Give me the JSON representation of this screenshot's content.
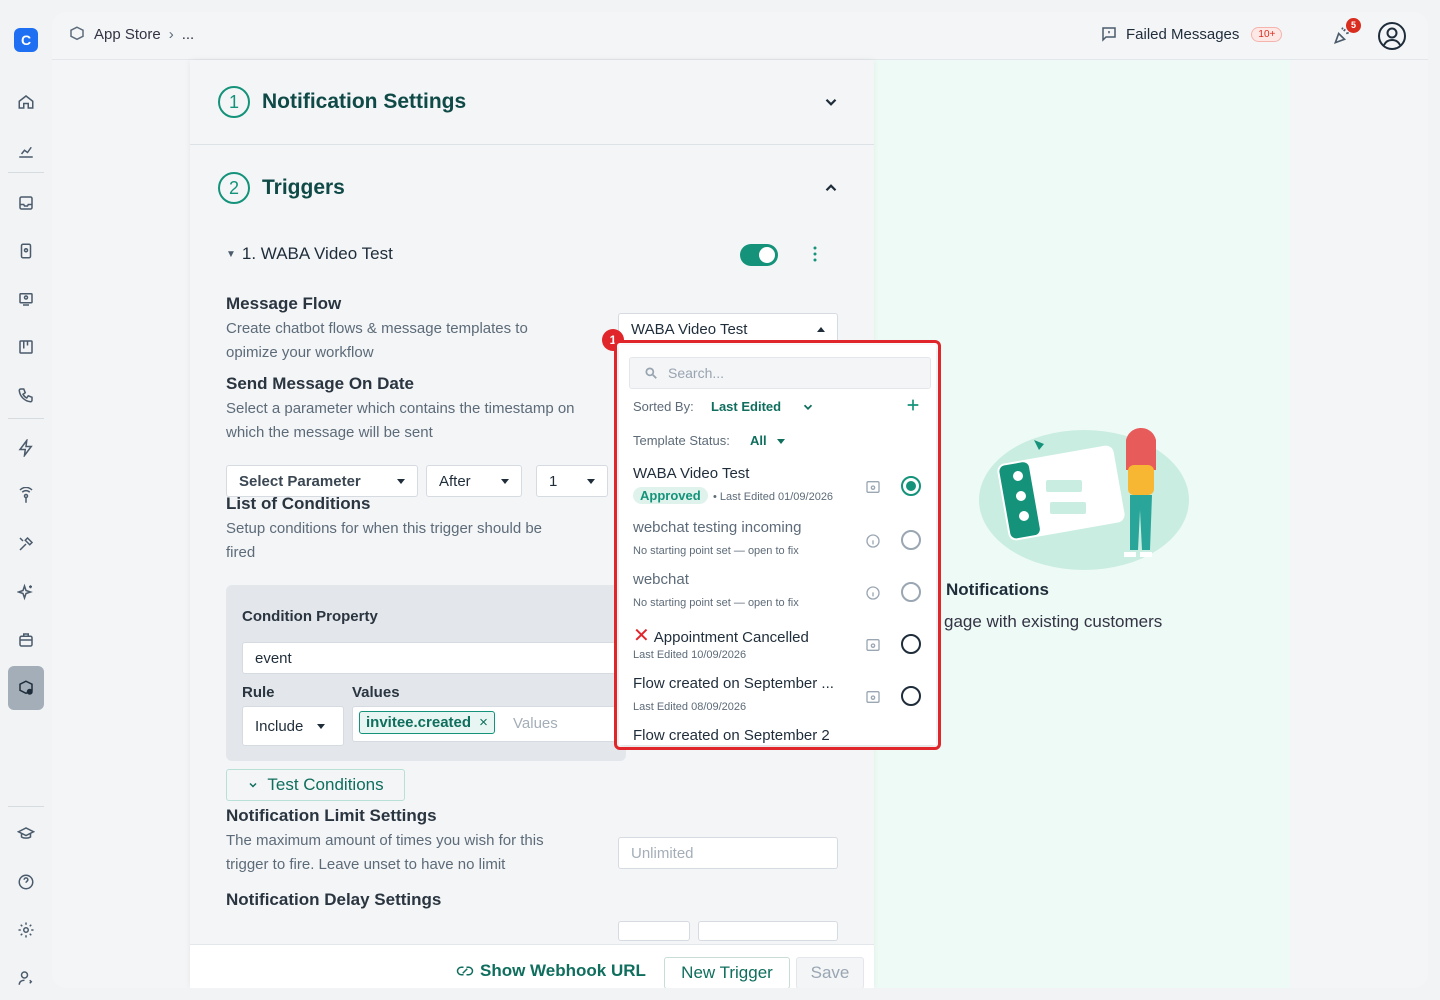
{
  "breadcrumb": {
    "app": "App Store",
    "more": "..."
  },
  "topbar": {
    "failed_label": "Failed Messages",
    "failed_count": "10+",
    "bell_count": "5"
  },
  "sections": {
    "notification_settings": {
      "step": "1",
      "title": "Notification Settings"
    },
    "triggers": {
      "step": "2",
      "title": "Triggers"
    }
  },
  "trigger": {
    "name": "1. WABA Video Test",
    "enabled": true
  },
  "message_flow": {
    "label": "Message Flow",
    "desc1": "Create chatbot flows & message templates to",
    "desc2": "opimize your workflow",
    "selected": "WABA Video Test"
  },
  "send_date": {
    "label": "Send Message On Date",
    "desc1": "Select a parameter which contains the timestamp on",
    "desc2": "which the message will be sent",
    "param": "Select Parameter",
    "when": "After",
    "amount": "1"
  },
  "conditions": {
    "label": "List of Conditions",
    "desc1": "Setup conditions for when this trigger should be",
    "desc2": "fired",
    "property_label": "Condition Property",
    "property_value": "event",
    "rule_label": "Rule",
    "rule_value": "Include",
    "values_label": "Values",
    "chip": "invitee.created",
    "values_placeholder": "Values"
  },
  "test_conditions": "Test Conditions",
  "limit": {
    "label": "Notification Limit Settings",
    "desc1": "The maximum amount of times you wish for this",
    "desc2": "trigger to fire. Leave unset to have no limit",
    "placeholder": "Unlimited"
  },
  "delay": {
    "label": "Notification Delay Settings"
  },
  "footer": {
    "webhook": "Show Webhook URL",
    "new_trigger": "New Trigger",
    "save": "Save"
  },
  "promo": {
    "title": "Notifications",
    "subtitle": "gage with existing customers"
  },
  "dropdown": {
    "badge": "1",
    "search_placeholder": "Search...",
    "sorted_label": "Sorted By:",
    "sorted_value": "Last Edited",
    "status_label": "Template Status:",
    "status_value": "All",
    "items": [
      {
        "title": "WABA Video Test",
        "badge": "Approved",
        "sub": "• Last Edited 01/09/2026"
      },
      {
        "title": "webchat testing incoming",
        "sub": "No starting point set — open to fix"
      },
      {
        "title": "webchat",
        "sub": "No starting point set — open to fix"
      },
      {
        "title": "Appointment Cancelled",
        "sub": "Last Edited 10/09/2026"
      },
      {
        "title": "Flow created on September ...",
        "sub": "Last Edited 08/09/2026"
      },
      {
        "title": "Flow created on September 2"
      }
    ]
  },
  "colors": {
    "accent": "#14937a",
    "highlight": "#e0262b"
  }
}
